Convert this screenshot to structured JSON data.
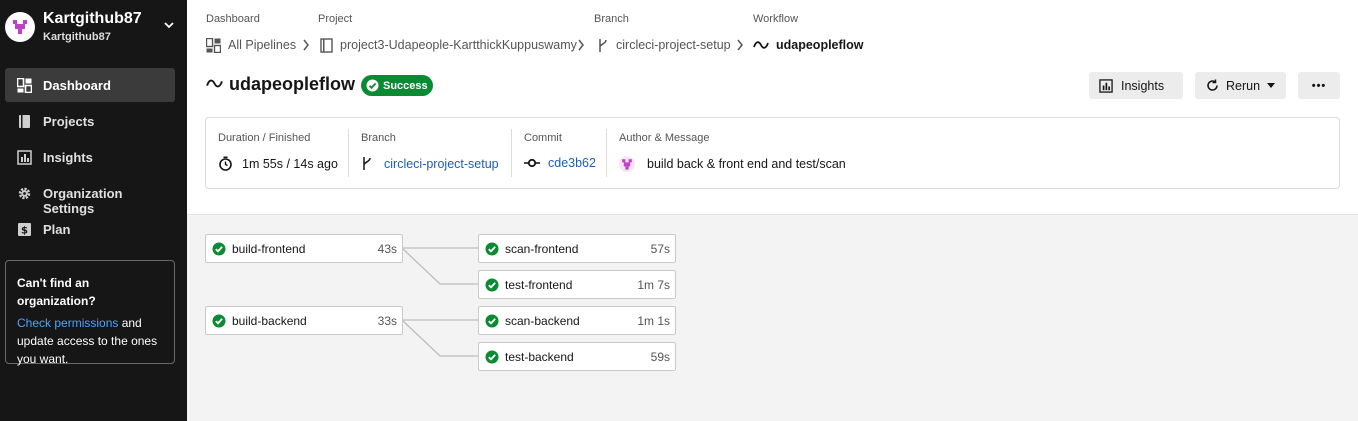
{
  "org": {
    "name": "Kartgithub87",
    "sub": "Kartgithub87"
  },
  "nav": [
    {
      "label": "Dashboard",
      "icon": "dashboard-icon",
      "active": true
    },
    {
      "label": "Projects",
      "icon": "book-icon",
      "active": false
    },
    {
      "label": "Insights",
      "icon": "bar-chart-icon",
      "active": false
    },
    {
      "label": "Organization Settings",
      "icon": "gear-icon",
      "active": false
    },
    {
      "label": "Plan",
      "icon": "dollar-icon",
      "active": false
    }
  ],
  "help": {
    "title": "Can't find an organization?",
    "link": "Check permissions",
    "text_after_link": " and update access to the ones you want."
  },
  "breadcrumb": {
    "labels": {
      "dashboard": "Dashboard",
      "project": "Project",
      "branch": "Branch",
      "workflow": "Workflow"
    },
    "dashboard": "All Pipelines",
    "project": "project3-Udapeople-KartthickKuppuswamy",
    "branch": "circleci-project-setup",
    "workflow": "udapeopleflow"
  },
  "header": {
    "title": "udapeopleflow",
    "status": "Success",
    "insights_label": "Insights",
    "rerun_label": "Rerun",
    "more_label": "•••"
  },
  "info": {
    "duration_label": "Duration / Finished",
    "duration_value": "1m 55s / 14s ago",
    "branch_label": "Branch",
    "branch_value": "circleci-project-setup",
    "commit_label": "Commit",
    "commit_value": "cde3b62",
    "author_label": "Author & Message",
    "message": "build back & front end and test/scan"
  },
  "jobs": {
    "build_frontend": {
      "name": "build-frontend",
      "time": "43s"
    },
    "build_backend": {
      "name": "build-backend",
      "time": "33s"
    },
    "scan_frontend": {
      "name": "scan-frontend",
      "time": "57s"
    },
    "test_frontend": {
      "name": "test-frontend",
      "time": "1m 7s"
    },
    "scan_backend": {
      "name": "scan-backend",
      "time": "1m 1s"
    },
    "test_backend": {
      "name": "test-backend",
      "time": "59s"
    }
  },
  "colors": {
    "sidebar_bg": "#161616",
    "success": "#0b8a34",
    "link": "#1b5fb5",
    "avatar_accent": "#c13fc9"
  }
}
